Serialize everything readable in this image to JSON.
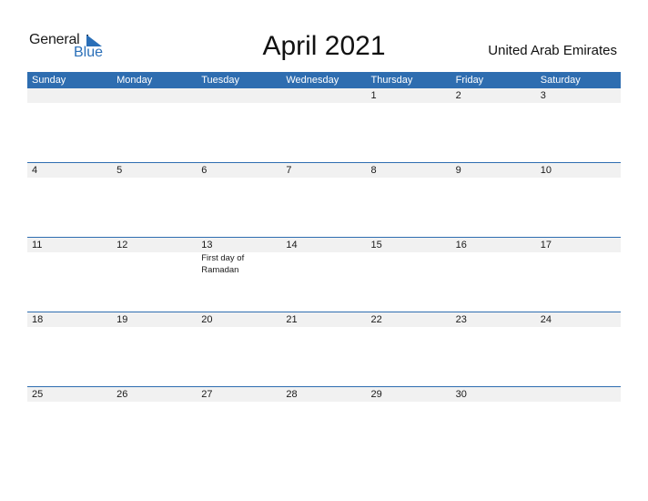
{
  "logo": {
    "word1": "General",
    "word2": "Blue",
    "brand_color": "#2a6fb8"
  },
  "title": "April 2021",
  "country": "United Arab Emirates",
  "header_color": "#2e6db0",
  "weekdays": [
    "Sunday",
    "Monday",
    "Tuesday",
    "Wednesday",
    "Thursday",
    "Friday",
    "Saturday"
  ],
  "weeks": [
    {
      "days": [
        {
          "num": "",
          "event": ""
        },
        {
          "num": "",
          "event": ""
        },
        {
          "num": "",
          "event": ""
        },
        {
          "num": "",
          "event": ""
        },
        {
          "num": "1",
          "event": ""
        },
        {
          "num": "2",
          "event": ""
        },
        {
          "num": "3",
          "event": ""
        }
      ]
    },
    {
      "days": [
        {
          "num": "4",
          "event": ""
        },
        {
          "num": "5",
          "event": ""
        },
        {
          "num": "6",
          "event": ""
        },
        {
          "num": "7",
          "event": ""
        },
        {
          "num": "8",
          "event": ""
        },
        {
          "num": "9",
          "event": ""
        },
        {
          "num": "10",
          "event": ""
        }
      ]
    },
    {
      "days": [
        {
          "num": "11",
          "event": ""
        },
        {
          "num": "12",
          "event": ""
        },
        {
          "num": "13",
          "event": "First day of Ramadan"
        },
        {
          "num": "14",
          "event": ""
        },
        {
          "num": "15",
          "event": ""
        },
        {
          "num": "16",
          "event": ""
        },
        {
          "num": "17",
          "event": ""
        }
      ]
    },
    {
      "days": [
        {
          "num": "18",
          "event": ""
        },
        {
          "num": "19",
          "event": ""
        },
        {
          "num": "20",
          "event": ""
        },
        {
          "num": "21",
          "event": ""
        },
        {
          "num": "22",
          "event": ""
        },
        {
          "num": "23",
          "event": ""
        },
        {
          "num": "24",
          "event": ""
        }
      ]
    },
    {
      "days": [
        {
          "num": "25",
          "event": ""
        },
        {
          "num": "26",
          "event": ""
        },
        {
          "num": "27",
          "event": ""
        },
        {
          "num": "28",
          "event": ""
        },
        {
          "num": "29",
          "event": ""
        },
        {
          "num": "30",
          "event": ""
        },
        {
          "num": "",
          "event": ""
        }
      ]
    }
  ]
}
